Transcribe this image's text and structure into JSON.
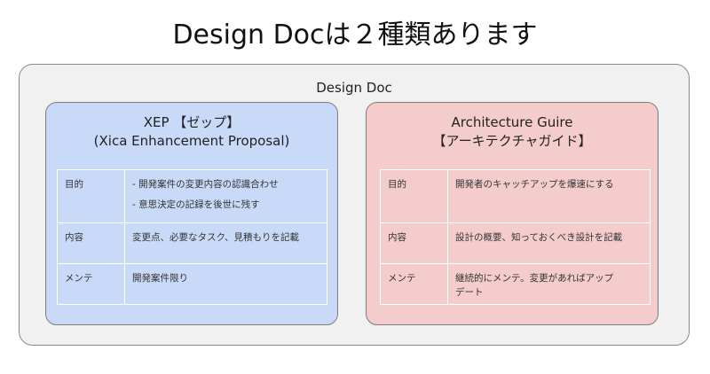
{
  "title": "Design Docは２種類あります",
  "outer": {
    "label": "Design Doc"
  },
  "cards": [
    {
      "title_line1": "XEP 【ゼップ】",
      "title_line2": "(Xica Enhancement Proposal)",
      "color": "#c9daf8",
      "rows": [
        {
          "label": "目的",
          "values": [
            "- 開発案件の変更内容の認識合わせ",
            "- 意思決定の記録を後世に残す"
          ]
        },
        {
          "label": "内容",
          "values": [
            "変更点、必要なタスク、見積もりを記載"
          ]
        },
        {
          "label": "メンテ",
          "values": [
            "開発案件限り"
          ]
        }
      ]
    },
    {
      "title_line1": "Architecture Guire",
      "title_line2": "【アーキテクチャガイド】",
      "color": "#f4cccc",
      "rows": [
        {
          "label": "目的",
          "values": [
            "開発者のキャッチアップを爆速にする"
          ]
        },
        {
          "label": "内容",
          "values": [
            "設計の概要、知っておくべき設計を記載"
          ]
        },
        {
          "label": "メンテ",
          "values": [
            "継続的にメンテ。変更があればアップ",
            "デート"
          ]
        }
      ]
    }
  ]
}
